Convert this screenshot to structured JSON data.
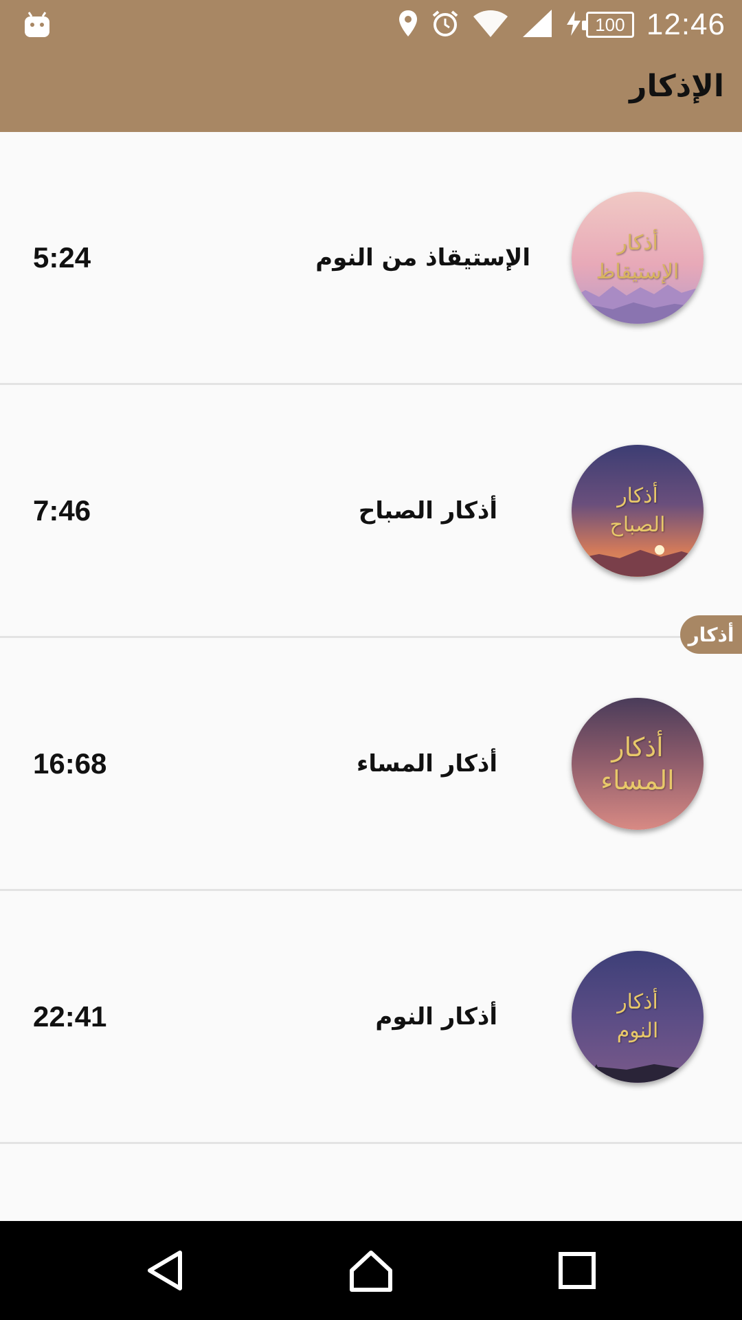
{
  "status_bar": {
    "time": "12:46",
    "battery": "100",
    "icons": [
      "android-icon",
      "location-icon",
      "alarm-icon",
      "wifi-icon",
      "signal-icon",
      "charging-icon",
      "battery-icon"
    ]
  },
  "app_bar": {
    "title": "الإذكار"
  },
  "items": [
    {
      "label": "الإستيقاذ من النوم",
      "time": "5:24",
      "thumb_line1": "أذكار",
      "thumb_line2": "الإستيقاظ"
    },
    {
      "label": "أذكار الصباح",
      "time": "7:46",
      "thumb_line1": "أذكار",
      "thumb_line2": "الصباح"
    },
    {
      "label": "أذكار المساء",
      "time": "16:68",
      "thumb_line1": "أذكار",
      "thumb_line2": "المساء"
    },
    {
      "label": "أذكار النوم",
      "time": "22:41",
      "thumb_line1": "أذكار",
      "thumb_line2": "النوم"
    }
  ],
  "floating_badge": "أذكار",
  "nav": {
    "icons": [
      "back-icon",
      "home-icon",
      "recents-icon"
    ]
  },
  "colors": {
    "accent": "#a88764",
    "background": "#fafafa",
    "divider": "#e3e3e3"
  }
}
